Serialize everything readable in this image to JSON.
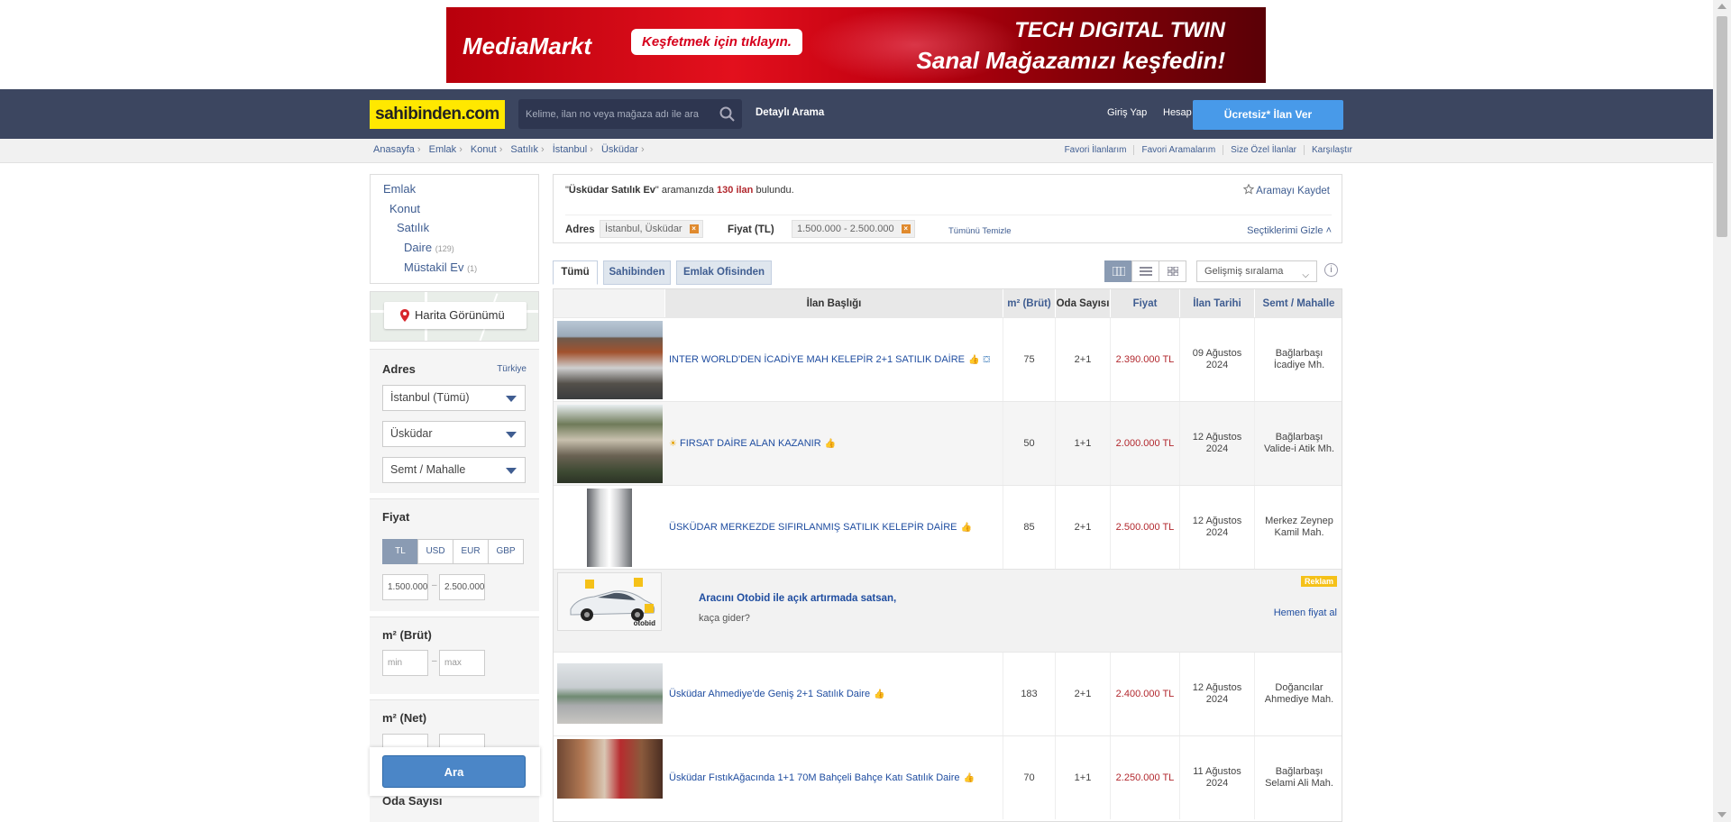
{
  "ad_banner": {
    "brand": "MediaMarkt",
    "cta": "Keşfetmek için tıklayın.",
    "line1": "TECH DIGITAL TWIN",
    "line2": "Sanal Mağazamızı keşfedin!"
  },
  "header": {
    "logo": "sahibinden.com",
    "search_placeholder": "Kelime, ilan no veya mağaza adı ile ara",
    "detailed_search": "Detaylı Arama",
    "login": "Giriş Yap",
    "register": "Hesap Aç",
    "free_ad": "Ücretsiz* İlan Ver"
  },
  "breadcrumb": [
    "Anasayfa",
    "Emlak",
    "Konut",
    "Satılık",
    "İstanbul",
    "Üsküdar"
  ],
  "crumb_links": [
    "Favori İlanlarım",
    "Favori Aramalarım",
    "Size Özel İlanlar",
    "Karşılaştır"
  ],
  "sidebar": {
    "categories": [
      {
        "label": "Emlak",
        "count": ""
      },
      {
        "label": "Konut",
        "count": ""
      },
      {
        "label": "Satılık",
        "count": ""
      },
      {
        "label": "Daire",
        "count": "(129)"
      },
      {
        "label": "Müstakil Ev",
        "count": "(1)"
      }
    ],
    "map_button": "Harita Görünümü",
    "address": {
      "title": "Adres",
      "country": "Türkiye",
      "city": "İstanbul (Tümü)",
      "district": "Üsküdar",
      "neighborhood": "Semt / Mahalle"
    },
    "price": {
      "title": "Fiyat",
      "currencies": [
        "TL",
        "USD",
        "EUR",
        "GBP"
      ],
      "active_currency": "TL",
      "min": "1.500.000",
      "max": "2.500.000"
    },
    "m2_gross": {
      "title": "m² (Brüt)",
      "min_placeholder": "min",
      "max_placeholder": "max"
    },
    "m2_net": {
      "title": "m² (Net)"
    },
    "rooms": {
      "title": "Oda Sayısı"
    },
    "search_button": "Ara"
  },
  "results": {
    "query": "Üsküdar Satılık Ev",
    "text_mid": "aramanızda",
    "count": "130 ilan",
    "text_end": "bulundu.",
    "save_search": "Aramayı Kaydet",
    "address_label": "Adres",
    "address_chip": "İstanbul, Üsküdar",
    "price_label": "Fiyat (TL)",
    "price_chip": "1.500.000 - 2.500.000",
    "clear_all": "Tümünü Temizle",
    "hide_selections": "Seçtiklerimi Gizle"
  },
  "tabs": [
    "Tümü",
    "Sahibinden",
    "Emlak Ofisinden"
  ],
  "sort": "Gelişmiş sıralama",
  "table": {
    "headers": [
      "İlan Başlığı",
      "m² (Brüt)",
      "Oda Sayısı",
      "Fiyat",
      "İlan Tarihi",
      "Semt / Mahalle"
    ],
    "rows": [
      {
        "title": "INTER WORLD'DEN İCADİYE MAH KELEPİR 2+1 SATILIK DAİRE",
        "m2": "75",
        "rooms": "2+1",
        "price": "2.390.000 TL",
        "date": "09 Ağustos 2024",
        "location": "Bağlarbaşı İcadiye Mh."
      },
      {
        "title": "FIRSAT DAİRE ALAN KAZANIR",
        "m2": "50",
        "rooms": "1+1",
        "price": "2.000.000 TL",
        "date": "12 Ağustos 2024",
        "location": "Bağlarbaşı Valide-i Atik Mh."
      },
      {
        "title": "ÜSKÜDAR MERKEZDE SIFIRLANMIŞ SATILIK KELEPİR DAİRE",
        "m2": "85",
        "rooms": "2+1",
        "price": "2.500.000 TL",
        "date": "12 Ağustos 2024",
        "location": "Merkez Zeynep Kamil Mah."
      },
      {
        "title": "Üsküdar Ahmediye'de Geniş 2+1 Satılık Daire",
        "m2": "183",
        "rooms": "2+1",
        "price": "2.400.000 TL",
        "date": "12 Ağustos 2024",
        "location": "Doğancılar Ahmediye Mah."
      },
      {
        "title": "Üsküdar FıstıkAğacında 1+1 70M Bahçeli Bahçe Katı Satılık Daire",
        "m2": "70",
        "rooms": "1+1",
        "price": "2.250.000 TL",
        "date": "11 Ağustos 2024",
        "location": "Bağlarbaşı Selami Ali Mah."
      }
    ],
    "ad": {
      "title": "Aracını Otobid ile açık artırmada satsan,",
      "subtitle": "kaça gider?",
      "badge": "Reklam",
      "link": "Hemen fiyat al",
      "logo": "otobid"
    }
  },
  "colors": {
    "topbar": "#3c4660",
    "logo_bg": "#ffe800",
    "accent_blue": "#489ae9",
    "price_red": "#b2282e",
    "link_blue": "#3f5d91"
  }
}
